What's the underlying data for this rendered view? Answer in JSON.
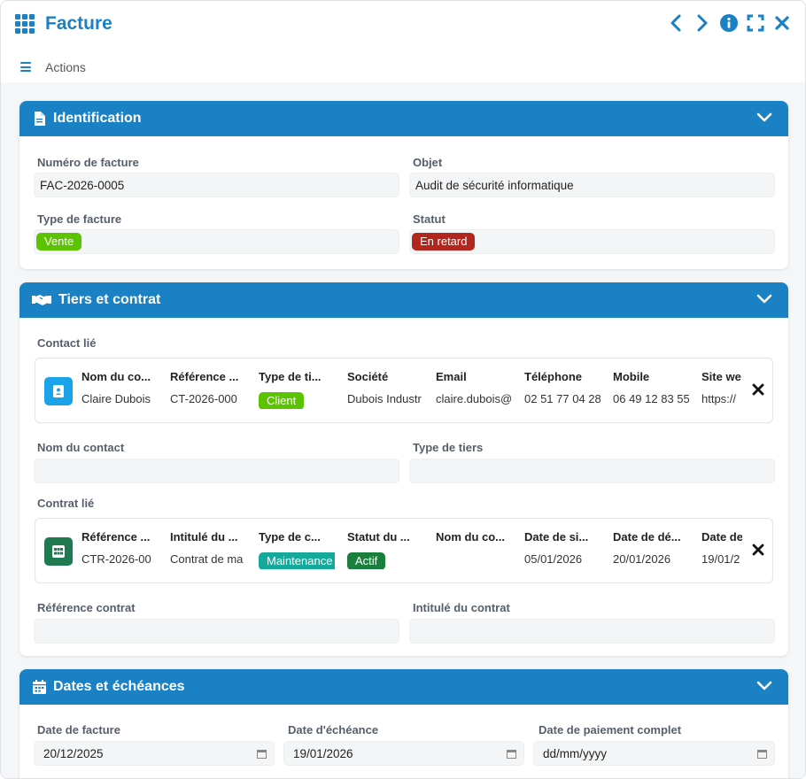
{
  "window": {
    "title": "Facture"
  },
  "actions": {
    "label": "Actions"
  },
  "identification": {
    "title": "Identification",
    "numero_label": "Numéro de facture",
    "numero_value": "FAC-2026-0005",
    "objet_label": "Objet",
    "objet_value": "Audit de sécurité informatique",
    "type_label": "Type de facture",
    "type_value": "Vente",
    "statut_label": "Statut",
    "statut_value": "En retard"
  },
  "tiers": {
    "title": "Tiers et contrat",
    "contact_label": "Contact lié",
    "contact_card": {
      "headers": [
        "Nom du co...",
        "Référence ...",
        "Type de ti...",
        "Société",
        "Email",
        "Téléphone",
        "Mobile",
        "Site we"
      ],
      "values": [
        "Claire Dubois",
        "CT-2026-000",
        "Client",
        "Dubois Industr",
        "claire.dubois@",
        "02 51 77 04 28",
        "06 49 12 83 55",
        "https://"
      ]
    },
    "nom_contact_label": "Nom du contact",
    "type_tiers_label": "Type de tiers",
    "contrat_label": "Contrat lié",
    "contrat_card": {
      "headers": [
        "Référence ...",
        "Intitulé du ...",
        "Type de c...",
        "Statut du ...",
        "Nom du co...",
        "Date de si...",
        "Date de dé...",
        "Date de"
      ],
      "values": [
        "CTR-2026-00",
        "Contrat de ma",
        "Maintenance",
        "Actif",
        "",
        "05/01/2026",
        "20/01/2026",
        "19/01/2"
      ]
    },
    "ref_contrat_label": "Référence contrat",
    "intitule_contrat_label": "Intitulé du contrat"
  },
  "dates": {
    "title": "Dates et échéances",
    "facture_label": "Date de facture",
    "facture_value": "20/12/2025",
    "echeance_label": "Date d'échéance",
    "echeance_value": "19/01/2026",
    "paiement_label": "Date de paiement complet",
    "paiement_placeholder": "dd/mm/yyyy"
  },
  "colors": {
    "primary": "#1a82c4",
    "vente": "#5cc300",
    "retard": "#b3261e",
    "client": "#5cc300",
    "maintenance": "#14a99a",
    "actif": "#1a7f3c",
    "contact_icon": "#1aa3e8",
    "contrat_icon": "#1f7a52"
  }
}
